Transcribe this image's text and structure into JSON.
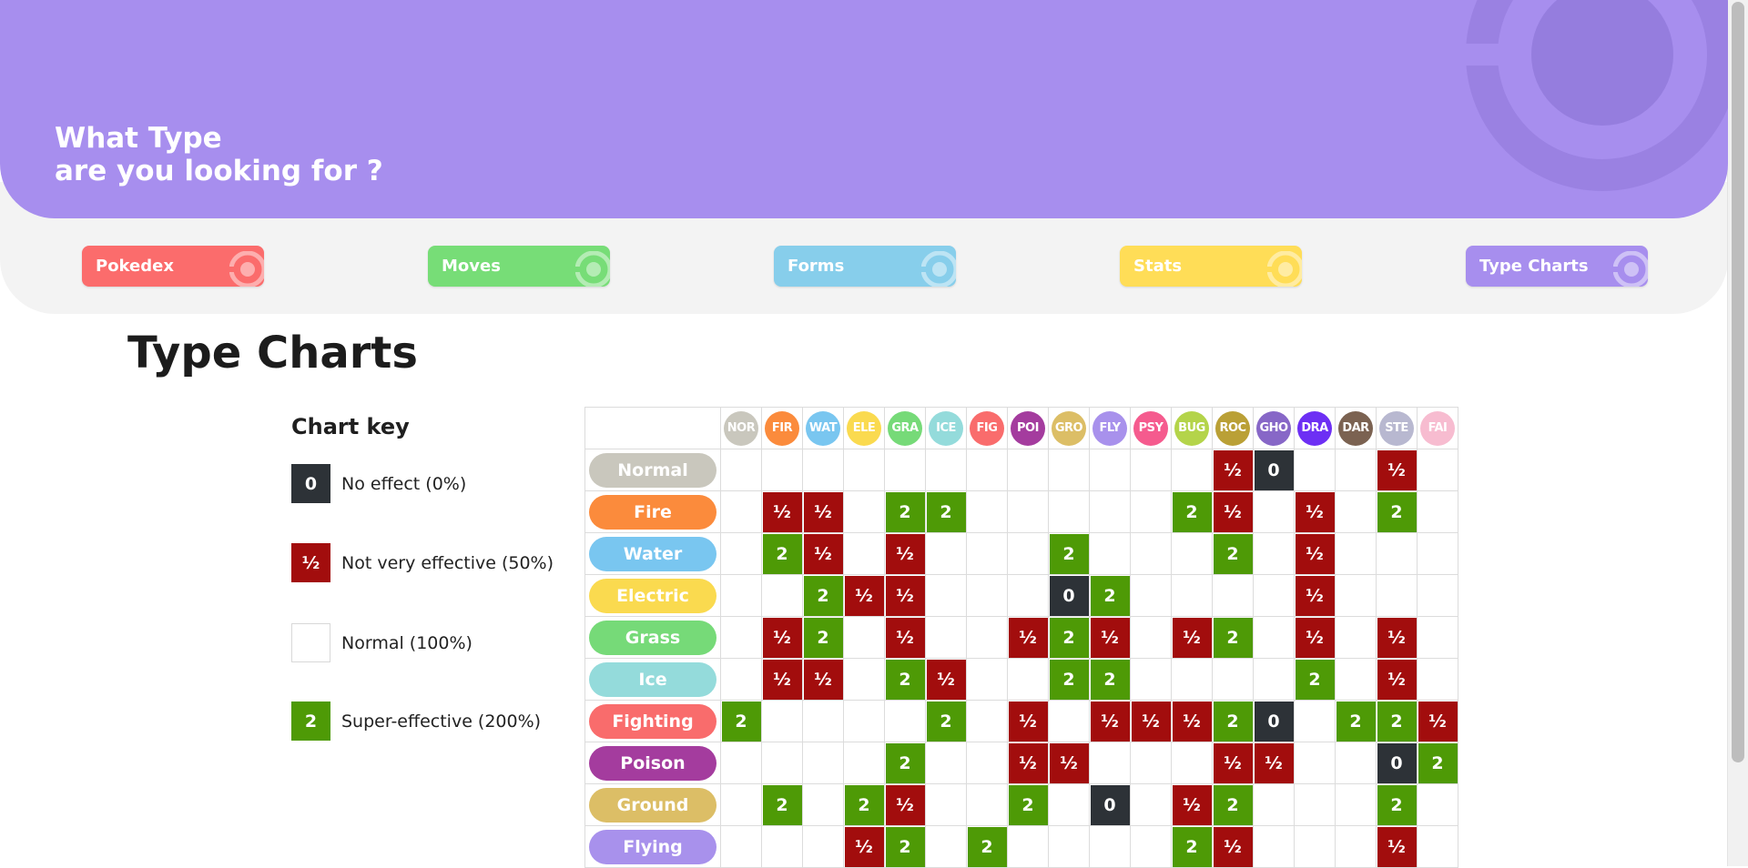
{
  "header": {
    "title_line1": "What Type",
    "title_line2": "are you looking for ?"
  },
  "nav": [
    {
      "label": "Pokedex",
      "color": "#fb6c6c"
    },
    {
      "label": "Moves",
      "color": "#77dd77"
    },
    {
      "label": "Forms",
      "color": "#87ceeb"
    },
    {
      "label": "Stats",
      "color": "#ffdd57"
    },
    {
      "label": "Type Charts",
      "color": "#a78eee"
    }
  ],
  "page_title": "Type Charts",
  "chart_key": {
    "title": "Chart key",
    "items": [
      {
        "symbol": "0",
        "label": "No effect (0%)",
        "color": "#2d3237"
      },
      {
        "symbol": "½",
        "label": "Not very effective (50%)",
        "color": "#a20d0d"
      },
      {
        "symbol": "",
        "label": "Normal (100%)",
        "color": "#ffffff"
      },
      {
        "symbol": "2",
        "label": "Super-effective (200%)",
        "color": "#4e9a06"
      }
    ]
  },
  "columns": [
    {
      "abbr": "NOR",
      "color": "#c9c7bd"
    },
    {
      "abbr": "FIR",
      "color": "#fb8b3c"
    },
    {
      "abbr": "WAT",
      "color": "#79c6f0"
    },
    {
      "abbr": "ELE",
      "color": "#fada4f"
    },
    {
      "abbr": "GRA",
      "color": "#76da78"
    },
    {
      "abbr": "ICE",
      "color": "#94dbdb"
    },
    {
      "abbr": "FIG",
      "color": "#f96c6c"
    },
    {
      "abbr": "POI",
      "color": "#a43c9e"
    },
    {
      "abbr": "GRO",
      "color": "#dcbe66"
    },
    {
      "abbr": "FLY",
      "color": "#a891ec"
    },
    {
      "abbr": "PSY",
      "color": "#f55b8e"
    },
    {
      "abbr": "BUG",
      "color": "#b4d44a"
    },
    {
      "abbr": "ROC",
      "color": "#baa036"
    },
    {
      "abbr": "GHO",
      "color": "#8767c7"
    },
    {
      "abbr": "DRA",
      "color": "#6d2ff4"
    },
    {
      "abbr": "DAR",
      "color": "#7b6251"
    },
    {
      "abbr": "STE",
      "color": "#b8b8d0"
    },
    {
      "abbr": "FAI",
      "color": "#f7bcd0"
    }
  ],
  "rows": [
    {
      "name": "Normal",
      "color": "#c9c7bd",
      "cells": [
        "",
        "",
        "",
        "",
        "",
        "",
        "",
        "",
        "",
        "",
        "",
        "",
        "½",
        "0",
        "",
        "",
        "½",
        ""
      ]
    },
    {
      "name": "Fire",
      "color": "#fb8b3c",
      "cells": [
        "",
        "½",
        "½",
        "",
        "2",
        "2",
        "",
        "",
        "",
        "",
        "",
        "2",
        "½",
        "",
        "½",
        "",
        "2",
        ""
      ]
    },
    {
      "name": "Water",
      "color": "#79c6f0",
      "cells": [
        "",
        "2",
        "½",
        "",
        "½",
        "",
        "",
        "",
        "2",
        "",
        "",
        "",
        "2",
        "",
        "½",
        "",
        "",
        ""
      ]
    },
    {
      "name": "Electric",
      "color": "#fada4f",
      "cells": [
        "",
        "",
        "2",
        "½",
        "½",
        "",
        "",
        "",
        "0",
        "2",
        "",
        "",
        "",
        "",
        "½",
        "",
        "",
        ""
      ]
    },
    {
      "name": "Grass",
      "color": "#76da78",
      "cells": [
        "",
        "½",
        "2",
        "",
        "½",
        "",
        "",
        "½",
        "2",
        "½",
        "",
        "½",
        "2",
        "",
        "½",
        "",
        "½",
        ""
      ]
    },
    {
      "name": "Ice",
      "color": "#94dbdb",
      "cells": [
        "",
        "½",
        "½",
        "",
        "2",
        "½",
        "",
        "",
        "2",
        "2",
        "",
        "",
        "",
        "",
        "2",
        "",
        "½",
        ""
      ]
    },
    {
      "name": "Fighting",
      "color": "#f96c6c",
      "cells": [
        "2",
        "",
        "",
        "",
        "",
        "2",
        "",
        "½",
        "",
        "½",
        "½",
        "½",
        "2",
        "0",
        "",
        "2",
        "2",
        "½"
      ]
    },
    {
      "name": "Poison",
      "color": "#a43c9e",
      "cells": [
        "",
        "",
        "",
        "",
        "2",
        "",
        "",
        "½",
        "½",
        "",
        "",
        "",
        "½",
        "½",
        "",
        "",
        "0",
        "2"
      ]
    },
    {
      "name": "Ground",
      "color": "#dcbe66",
      "cells": [
        "",
        "2",
        "",
        "2",
        "½",
        "",
        "",
        "2",
        "",
        "0",
        "",
        "½",
        "2",
        "",
        "",
        "",
        "2",
        ""
      ]
    },
    {
      "name": "Flying",
      "color": "#a891ec",
      "cells": [
        "",
        "",
        "",
        "½",
        "2",
        "",
        "2",
        "",
        "",
        "",
        "",
        "2",
        "½",
        "",
        "",
        "",
        "½",
        ""
      ]
    }
  ],
  "colors": {
    "super": "#4e9a06",
    "half": "#a20d0d",
    "zero": "#2d3237",
    "accent": "#a78eee"
  },
  "icons": [
    "pokeball-icon"
  ]
}
